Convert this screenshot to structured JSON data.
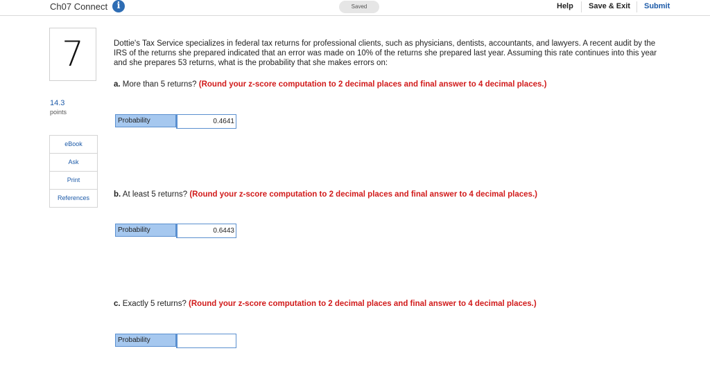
{
  "header": {
    "title": "Ch07 Connect",
    "info_icon": "info-icon",
    "saved_status": "Saved",
    "help_label": "Help",
    "save_exit_label": "Save & Exit",
    "submit_label": "Submit",
    "accent_color": "#1c5aa8"
  },
  "question": {
    "number": "7",
    "points_value": "14.3",
    "points_label": "points",
    "text": "Dottie's Tax Service specializes in federal tax returns for professional clients, such as physicians, dentists, accountants, and lawyers. A recent audit by the IRS of the returns she prepared indicated that an error was made on 10% of the returns she prepared last year. Assuming this rate continues into this year and she prepares 53 returns, what is the probability that she makes errors on:",
    "instruction_color": "#d11a1a"
  },
  "resources": {
    "ebook": "eBook",
    "ask": "Ask",
    "print": "Print",
    "references": "References"
  },
  "parts": [
    {
      "label": "a.",
      "prompt": "More than 5 returns?",
      "instruction": "(Round your z-score computation to 2 decimal places and final answer to 4 decimal places.)",
      "answer_label": "Probability",
      "answer_value": "0.4641"
    },
    {
      "label": "b.",
      "prompt": "At least 5 returns?",
      "instruction": "(Round your z-score computation to 2 decimal places and final answer to 4 decimal places.)",
      "answer_label": "Probability",
      "answer_value": "0.6443"
    },
    {
      "label": "c.",
      "prompt": "Exactly 5 returns?",
      "instruction": "(Round your z-score computation to 2 decimal places and final answer to 4 decimal places.)",
      "answer_label": "Probability",
      "answer_value": ""
    }
  ]
}
